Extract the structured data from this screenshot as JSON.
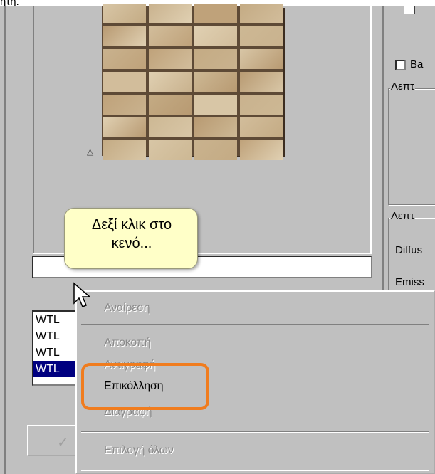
{
  "caption": "ητή.",
  "tooltip": {
    "line1": "Δεξί κλικ στο",
    "line2": "κενό..."
  },
  "right_panel": {
    "checkbox_label": "Ba",
    "group1_title": "Λεπτ",
    "group2_title": "Λεπτ",
    "diffuse_label": "Diffus",
    "emissive_label": "Emiss"
  },
  "textbox": {
    "value": ""
  },
  "list": {
    "items": [
      "WTL",
      "WTL",
      "WTL",
      "WTL"
    ],
    "selected_index": 3
  },
  "context_menu": {
    "undo": "Αναίρεση",
    "cut": "Αποκοπή",
    "copy": "Αντιγραφή",
    "paste": "Επικόλληση",
    "delete": "Διαγραφή",
    "select_all": "Επιλογή όλων"
  },
  "colors": {
    "highlight": "#f07c1e",
    "selection": "#000080",
    "tooltip_bg": "#ffffc8"
  },
  "icons": {
    "cursor": "arrow-cursor-icon",
    "ok": "checkmark-icon",
    "sort": "triangle-icon"
  }
}
